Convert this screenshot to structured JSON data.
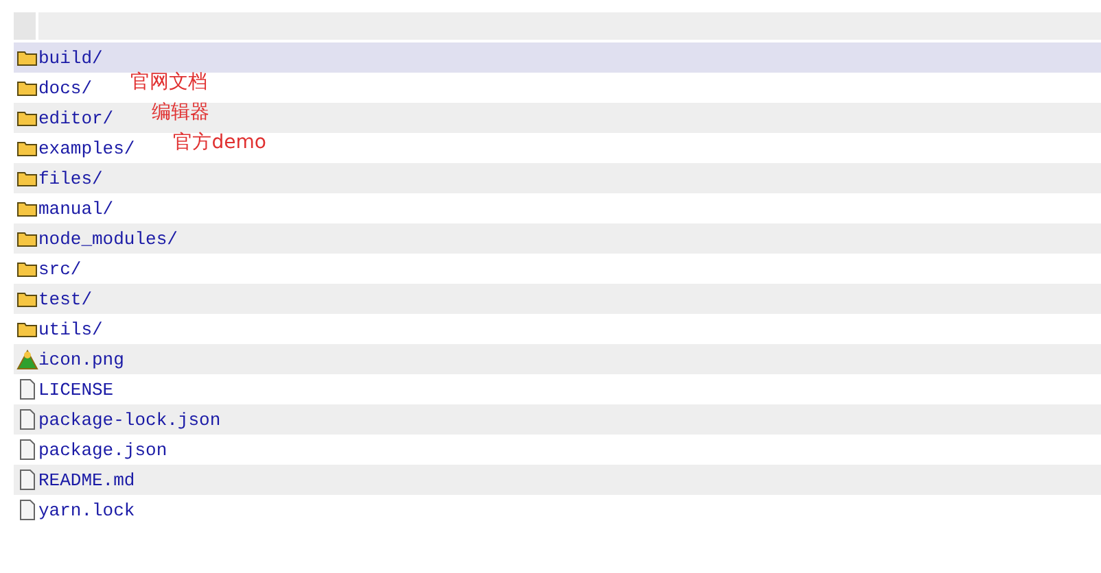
{
  "entries": [
    {
      "kind": "folder",
      "name": "build/",
      "selected": true
    },
    {
      "kind": "folder",
      "name": "docs/",
      "selected": false,
      "note": "官网文档"
    },
    {
      "kind": "folder",
      "name": "editor/",
      "selected": false,
      "note": "编辑器"
    },
    {
      "kind": "folder",
      "name": "examples/",
      "selected": false,
      "note": "官方demo"
    },
    {
      "kind": "folder",
      "name": "files/",
      "selected": false
    },
    {
      "kind": "folder",
      "name": "manual/",
      "selected": false
    },
    {
      "kind": "folder",
      "name": "node_modules/",
      "selected": false
    },
    {
      "kind": "folder",
      "name": "src/",
      "selected": false
    },
    {
      "kind": "folder",
      "name": "test/",
      "selected": false
    },
    {
      "kind": "folder",
      "name": "utils/",
      "selected": false
    },
    {
      "kind": "image",
      "name": "icon.png",
      "selected": false
    },
    {
      "kind": "file",
      "name": "LICENSE",
      "selected": false
    },
    {
      "kind": "file",
      "name": "package-lock.json",
      "selected": false
    },
    {
      "kind": "file",
      "name": "package.json",
      "selected": false
    },
    {
      "kind": "file",
      "name": "README.md",
      "selected": false
    },
    {
      "kind": "file",
      "name": "yarn.lock",
      "selected": false
    }
  ]
}
